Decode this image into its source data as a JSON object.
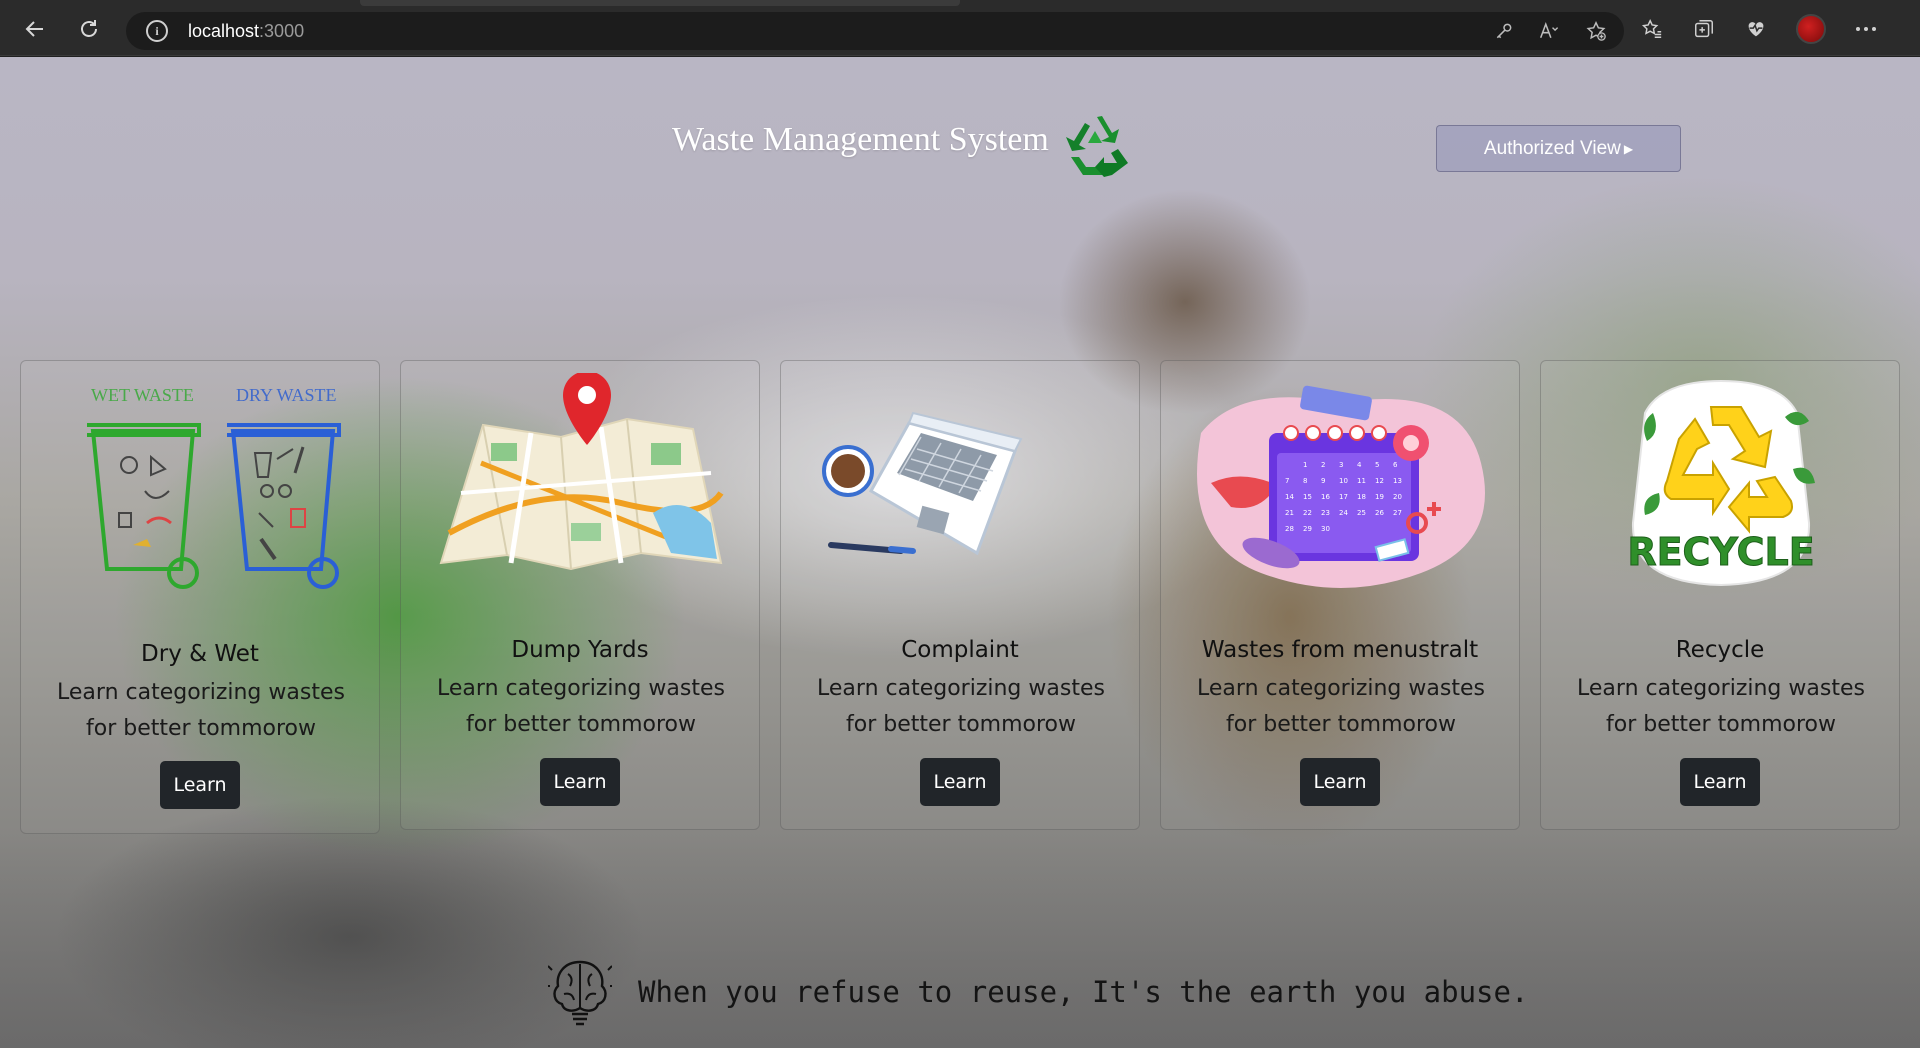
{
  "browser": {
    "url_host": "localhost",
    "url_port": ":3000",
    "icons": [
      "back-icon",
      "reload-icon",
      "info-icon",
      "key-icon",
      "read-aloud-icon",
      "add-favorite-icon",
      "favorites-icon",
      "collections-icon",
      "health-icon",
      "profile-avatar",
      "more-icon"
    ]
  },
  "header": {
    "title": "Waste Management System",
    "auth_button": "Authorized View",
    "colors": {
      "logo": "#1a8f2e"
    }
  },
  "cards": [
    {
      "title": "Dry & Wet",
      "text": "Learn categorizing wastes for better tommorow",
      "button": "Learn",
      "image": "dry-wet-bins-illustration",
      "img_labels": [
        "WET WASTE",
        "DRY WASTE"
      ]
    },
    {
      "title": "Dump Yards",
      "text": "Learn categorizing wastes for better tommorow",
      "button": "Learn",
      "image": "map-pin-illustration"
    },
    {
      "title": "Complaint",
      "text": "Learn categorizing wastes for better tommorow",
      "button": "Learn",
      "image": "laptop-coffee-illustration"
    },
    {
      "title": "Wastes from menustralt",
      "text": "Learn categorizing wastes for better tommorow",
      "button": "Learn",
      "image": "menstrual-calendar-illustration",
      "calendar_days": [
        "1",
        "2",
        "3",
        "4",
        "5",
        "6",
        "7",
        "8",
        "9",
        "10",
        "11",
        "12",
        "13",
        "14",
        "15",
        "16",
        "17",
        "18",
        "19",
        "20",
        "21",
        "22",
        "23",
        "24",
        "25",
        "26",
        "27",
        "28",
        "29",
        "30"
      ]
    },
    {
      "title": "Recycle",
      "text": "Learn categorizing wastes for better tommorow",
      "button": "Learn",
      "image": "recycle-sticker-illustration",
      "sticker_label": "RECYCLE"
    }
  ],
  "quote": {
    "text": "When you refuse to reuse, It's the earth you abuse.",
    "icon": "brain-bulb-icon"
  },
  "colors": {
    "learn_button": "#212529",
    "auth_button_bg": "#9a9ac0"
  }
}
